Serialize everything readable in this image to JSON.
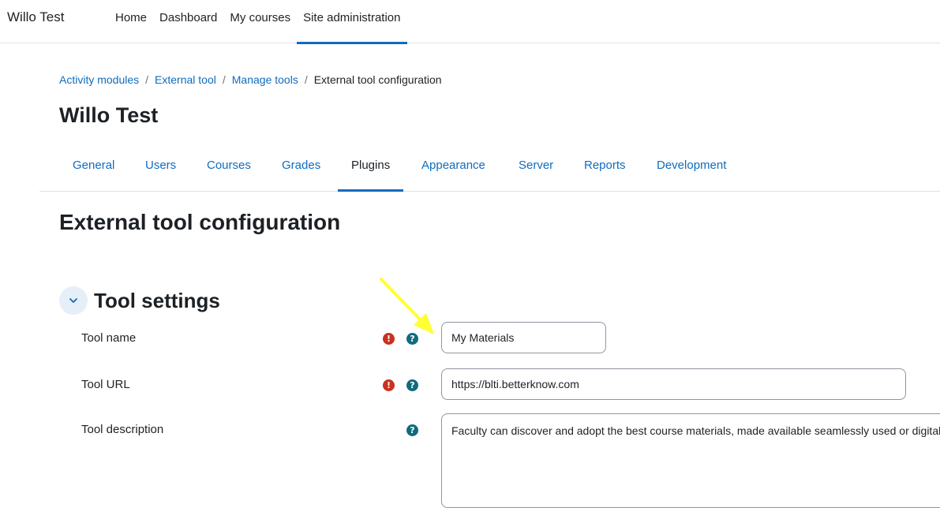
{
  "navbar": {
    "brand": "Willo Test",
    "items": [
      {
        "label": "Home",
        "active": false
      },
      {
        "label": "Dashboard",
        "active": false
      },
      {
        "label": "My courses",
        "active": false
      },
      {
        "label": "Site administration",
        "active": true
      }
    ]
  },
  "breadcrumb": {
    "items": [
      "Activity modules",
      "External tool",
      "Manage tools"
    ],
    "current": "External tool configuration",
    "separator": "/"
  },
  "site_title": "Willo Test",
  "tabs": [
    {
      "label": "General"
    },
    {
      "label": "Users"
    },
    {
      "label": "Courses"
    },
    {
      "label": "Grades"
    },
    {
      "label": "Plugins",
      "active": true
    },
    {
      "label": "Appearance"
    },
    {
      "label": "Server"
    },
    {
      "label": "Reports"
    },
    {
      "label": "Development"
    }
  ],
  "page_heading": "External tool configuration",
  "section": {
    "title": "Tool settings",
    "fields": {
      "tool_name": {
        "label": "Tool name",
        "value": "My Materials"
      },
      "tool_url": {
        "label": "Tool URL",
        "value": "https://blti.betterknow.com"
      },
      "tool_description": {
        "label": "Tool description",
        "value": "Faculty can discover and adopt the best course materials, made available seamlessly used or digital."
      }
    }
  },
  "icons": {
    "required": "!",
    "help": "?"
  },
  "colors": {
    "link": "#0f6cbf",
    "required": "#ca3120",
    "help": "#0f6b7e",
    "annotation_arrow": "#ffff33"
  }
}
